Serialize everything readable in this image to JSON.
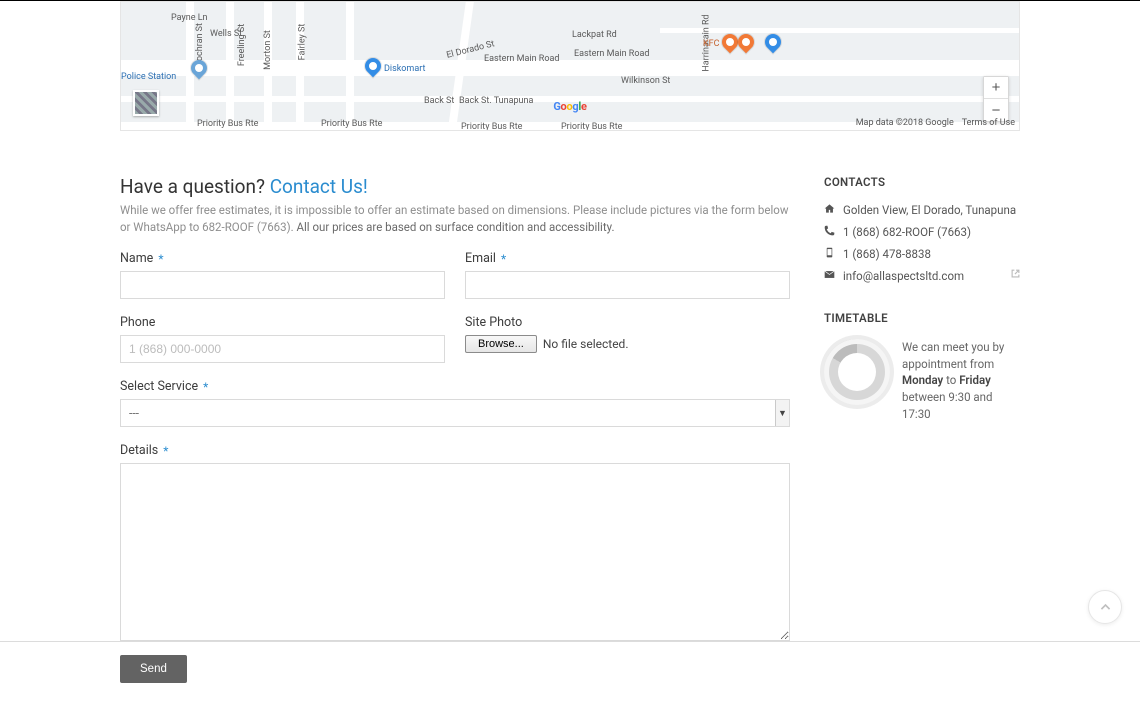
{
  "map": {
    "roads": {
      "eastern_main": "Eastern Main Road",
      "lackpat": "Lackpat Rd",
      "wilkinson": "Wilkinson St",
      "priority": "Priority Bus Rte",
      "back_st": "Back St",
      "back_st_tunapuna": "Back St. Tunapuna",
      "payne": "Payne Ln",
      "wells": "Wells St",
      "cochran": "Cochran St",
      "morton": "Morton St",
      "freeling": "Freeling St",
      "fairley": "Fairley St",
      "eldorado": "El Dorado St",
      "harrinarain": "Harrinarain Rd"
    },
    "pois": {
      "diskomart": "Diskomart",
      "kfc": "KFC",
      "police": "Police Station"
    },
    "attribution": {
      "data": "Map data ©2018 Google",
      "terms": "Terms of Use"
    },
    "zoom_in": "+",
    "zoom_out": "−"
  },
  "headline": {
    "prefix": "Have a question? ",
    "link": "Contact Us!"
  },
  "intro": {
    "light": "While we offer free estimates, it is impossible to offer an estimate based on dimensions. Please include pictures via the form below or WhatsApp to 682-ROOF (7663). ",
    "strong": "All our prices are based on surface condition and accessibility."
  },
  "form": {
    "name_label": "Name",
    "email_label": "Email",
    "phone_label": "Phone",
    "phone_placeholder": "1 (868) 000-0000",
    "site_photo_label": "Site Photo",
    "browse_label": "Browse...",
    "no_file": "No file selected.",
    "service_label": "Select Service",
    "service_value": "---",
    "details_label": "Details",
    "send_label": "Send"
  },
  "sidebar": {
    "contacts_title": "CONTACTS",
    "address": "Golden View, El Dorado, Tunapuna",
    "phone1": "1 (868) 682-ROOF (7663)",
    "phone2": "1 (868) 478-8838",
    "email": "info@allaspectsltd.com",
    "timetable_title": "TIMETABLE",
    "tt_pre": "We can meet you by appointment from ",
    "tt_day1": "Monday",
    "tt_mid": " to ",
    "tt_day2": "Friday",
    "tt_post": " between 9:30 and 17:30"
  }
}
